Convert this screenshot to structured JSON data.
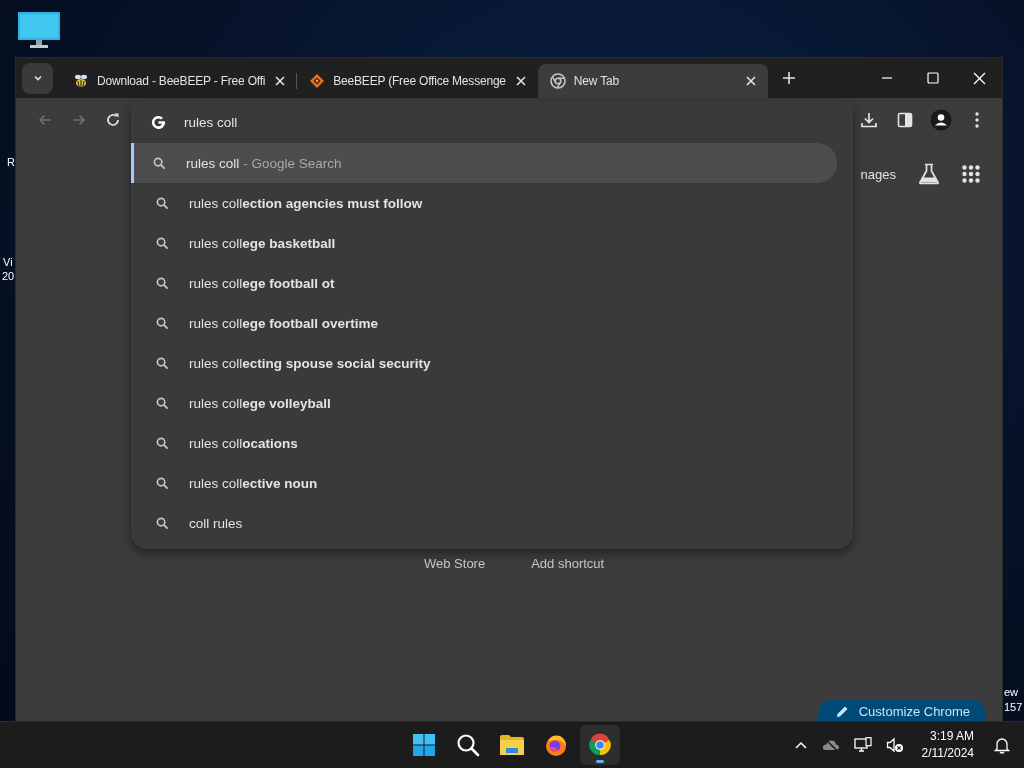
{
  "desktop": {
    "left_labels": [
      "R",
      "Vi",
      "20"
    ],
    "right_labels": [
      "ew",
      "157"
    ]
  },
  "browser": {
    "tabs": [
      {
        "title": "Download - BeeBEEP - Free Offi",
        "kind": "bee",
        "selected": false
      },
      {
        "title": "BeeBEEP (Free Office Messenge",
        "kind": "diamond",
        "selected": false
      },
      {
        "title": "New Tab",
        "kind": "chrome",
        "selected": true
      }
    ],
    "navigation": {
      "back": {
        "disabled": true
      },
      "forward": {
        "disabled": true
      }
    },
    "omnibox": {
      "value": "rules coll"
    },
    "suggestions": [
      {
        "text": "rules coll",
        "suffix": "- Google Search",
        "selected": true
      },
      {
        "text": "rules coll**ection agencies must follow**",
        "selected": false
      },
      {
        "text": "rules coll**ege basketball**",
        "selected": false
      },
      {
        "text": "rules coll**ege football ot**",
        "selected": false
      },
      {
        "text": "rules coll**ege football overtime**",
        "selected": false
      },
      {
        "text": "rules coll**ecting spouse social security**",
        "selected": false
      },
      {
        "text": "rules coll**ege volleyball**",
        "selected": false
      },
      {
        "text": "rules coll**ocations**",
        "selected": false
      },
      {
        "text": "rules coll**ective noun**",
        "selected": false
      },
      {
        "text": "coll rules",
        "selected": false
      }
    ]
  },
  "new_tab_page": {
    "header_link": "nages",
    "shortcuts": [
      "Web Store",
      "Add shortcut"
    ],
    "customize_button": "Customize Chrome"
  },
  "taskbar": {
    "apps": [
      {
        "kind": "start",
        "active": false
      },
      {
        "kind": "search",
        "active": false
      },
      {
        "kind": "explorer",
        "active": false
      },
      {
        "kind": "firefox",
        "active": false
      },
      {
        "kind": "chrome",
        "active": true
      }
    ],
    "clock": {
      "time": "3:19 AM",
      "date": "2/11/2024"
    }
  }
}
